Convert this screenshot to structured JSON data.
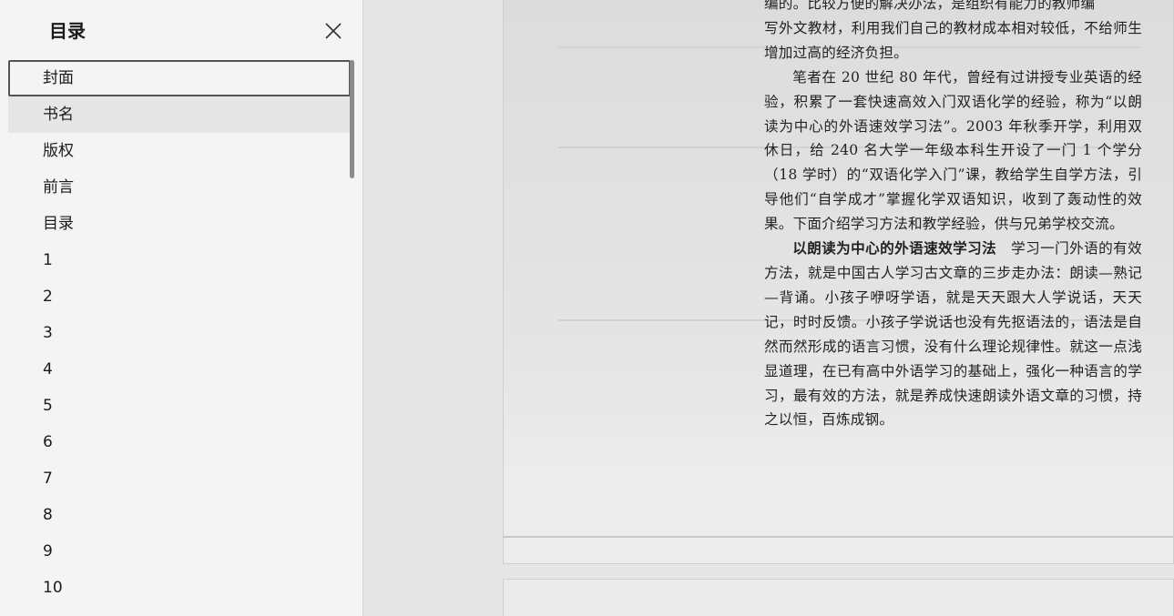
{
  "toc": {
    "title": "目录",
    "items": [
      {
        "label": "封面"
      },
      {
        "label": "书名"
      },
      {
        "label": "版权"
      },
      {
        "label": "前言"
      },
      {
        "label": "目录"
      },
      {
        "label": "1"
      },
      {
        "label": "2"
      },
      {
        "label": "3"
      },
      {
        "label": "4"
      },
      {
        "label": "5"
      },
      {
        "label": "6"
      },
      {
        "label": "7"
      },
      {
        "label": "8"
      },
      {
        "label": "9"
      },
      {
        "label": "10"
      }
    ]
  },
  "page": {
    "line_top": "编的。比较方便的解决办法，是组织有能力的教师编",
    "para1_end": "写外文教材，利用我们自己的教材成本相对较低，不给师生增加过高的经济负担。",
    "para2": "笔者在 20 世纪 80 年代，曾经有过讲授专业英语的经验，积累了一套快速高效入门双语化学的经验，称为“以朗读为中心的外语速效学习法”。2003 年秋季开学，利用双休日，给 240 名大学一年级本科生开设了一门 1 个学分（18 学时）的“双语化学入门”课，教给学生自学方法，引导他们“自学成才”掌握化学双语知识，收到了轰动性的效果。下面介绍学习方法和教学经验，供与兄弟学校交流。",
    "para3_heading": "以朗读为中心的外语速效学习法",
    "para3_body": "　学习一门外语的有效方法，就是中国古人学习古文章的三步走办法：朗读—熟记—背诵。小孩子咿呀学语，就是天天跟大人学说话，天天记，时时反馈。小孩子学说话也没有先抠语法的，语法是自然而然形成的语言习惯，没有什么理论规律性。就这一点浅显道理，在已有高中外语学习的基础上，强化一种语言的学习，最有效的方法，就是养成快速朗读外语文章的习惯，持之以恒，百炼成钢。"
  }
}
